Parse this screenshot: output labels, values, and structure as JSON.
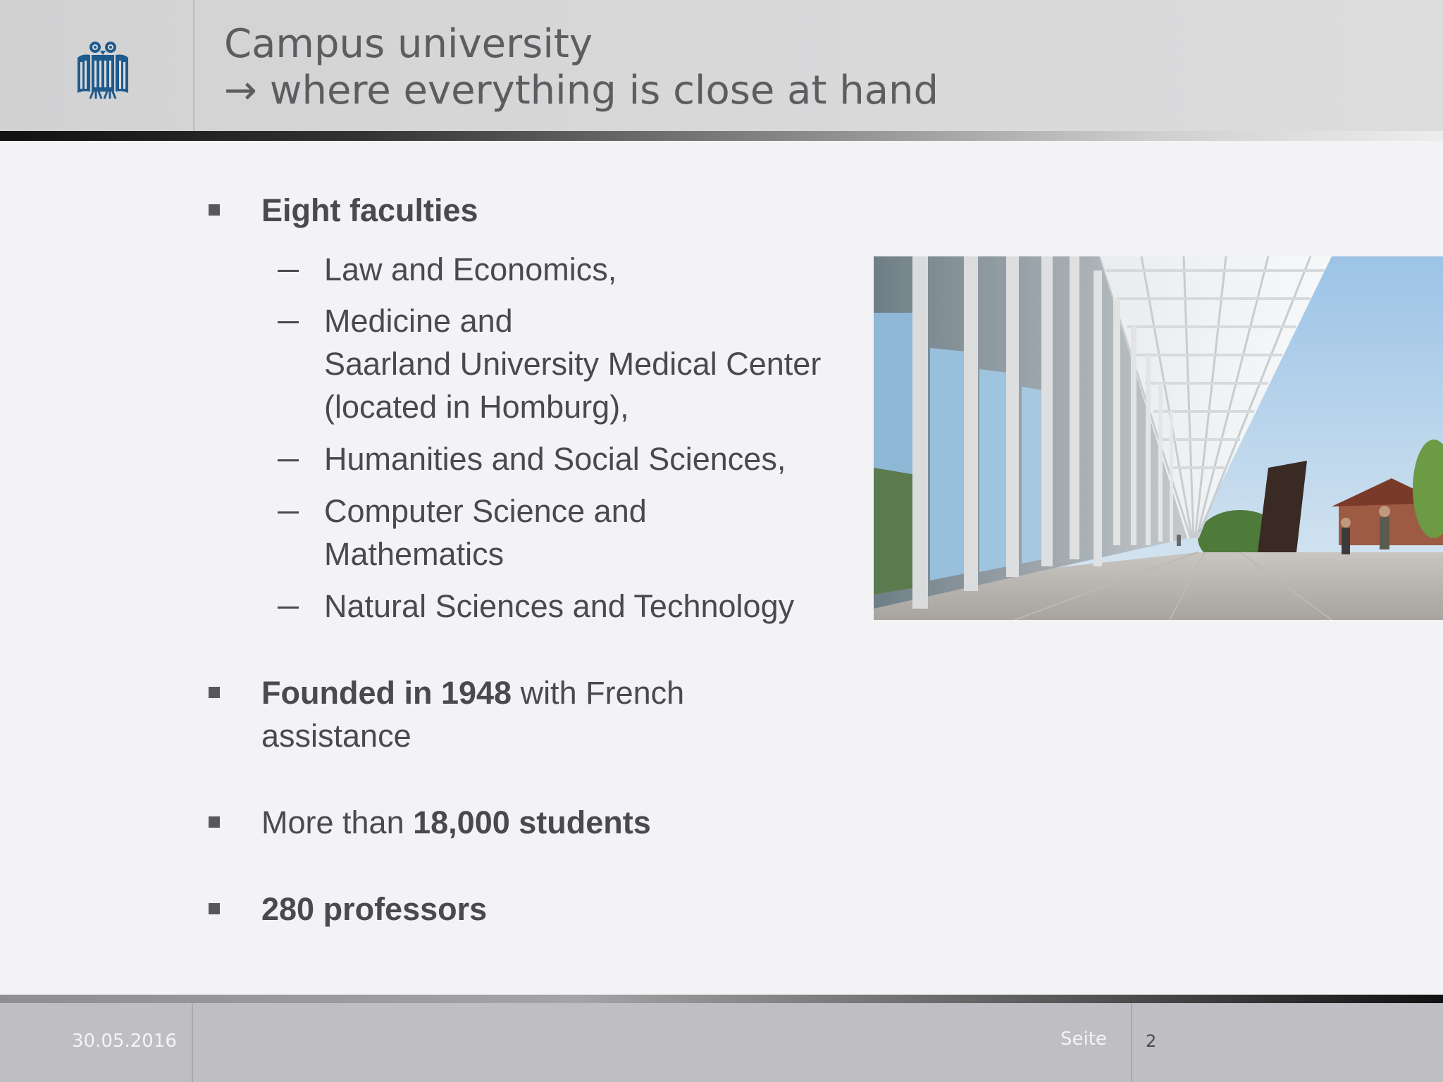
{
  "header": {
    "title_line1": "Campus university",
    "title_line2": "→ where everything is close at hand",
    "logo_icon": "owl-seal-icon"
  },
  "bullets": {
    "faculties_heading": "Eight faculties",
    "faculties": [
      {
        "lines": [
          "Law and Economics,"
        ]
      },
      {
        "lines": [
          "Medicine and",
          "Saarland University Medical Center",
          "(located in Homburg),"
        ]
      },
      {
        "lines": [
          "Humanities and Social Sciences,"
        ]
      },
      {
        "lines": [
          "Computer Science and",
          "Mathematics"
        ]
      },
      {
        "lines": [
          "Natural Sciences and Technology"
        ]
      }
    ],
    "founded_bold": "Founded in 1948",
    "founded_rest": " with French",
    "founded_line2": "assistance",
    "students_pre": "More than ",
    "students_bold": "18,000 students",
    "professors": "280 professors"
  },
  "photo": {
    "icon": "campus-building-photo"
  },
  "footer": {
    "date": "30.05.2016",
    "seite_label": "Seite",
    "page_number": "2"
  },
  "colors": {
    "text": "#4a4a4d",
    "logo_blue": "#1e5a8c",
    "header_bg": "#d6d6d7",
    "footer_bg": "#bfbec2",
    "body_bg": "#f3f2f4"
  }
}
